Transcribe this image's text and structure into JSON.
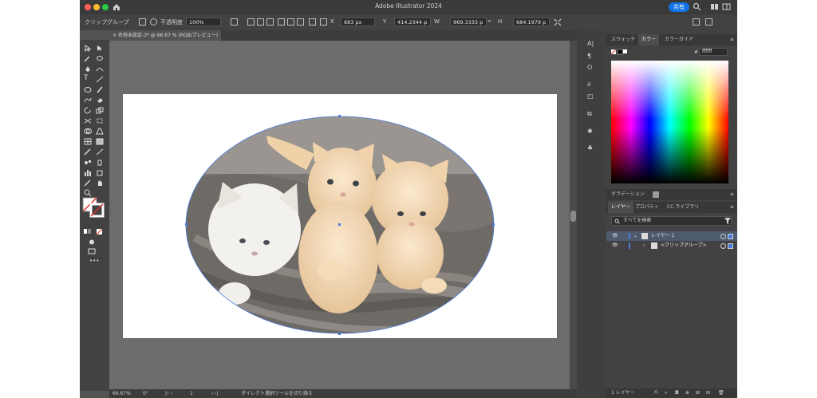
{
  "app": {
    "title": "Adobe Illustrator 2024",
    "share_label": "共有"
  },
  "control_bar": {
    "selection_label": "クリップグループ",
    "opacity_label": "不透明度",
    "opacity_value": "100%",
    "x_label": "X",
    "x_value": "683 px",
    "y_label": "Y",
    "y_value": "414.2344 p",
    "w_label": "W",
    "w_value": "969.3333 p",
    "h_label": "H",
    "h_value": "684.1979 p"
  },
  "document": {
    "tab_label": "名称未設定-3* @ 66.67 % (RGB/プレビュー)"
  },
  "status_bar": {
    "zoom": "66.67%",
    "rotation": "0°",
    "artboard_number": "1",
    "tool_hint": "ダイレクト選択ツールを切り換え"
  },
  "color_panel": {
    "tabs": [
      "スウォッチ",
      "カラー",
      "カラーガイド"
    ],
    "active_tab": "カラー",
    "hex_value": "ffffff"
  },
  "gradient_panel": {
    "tab_label": "グラデーション"
  },
  "layers_panel": {
    "tabs": [
      "レイヤー",
      "プロパティ",
      "CC ライブラリ"
    ],
    "search_placeholder": "すべてを検索",
    "layers": [
      {
        "name": "レイヤー 1"
      },
      {
        "name": "<クリップグループ>"
      }
    ],
    "footer_count": "1 レイヤー"
  },
  "colors": {
    "accent": "#1473e6",
    "selection_outline": "#4a7bdc",
    "ui_dark": "#424242",
    "pasteboard": "#6c6c6c"
  }
}
